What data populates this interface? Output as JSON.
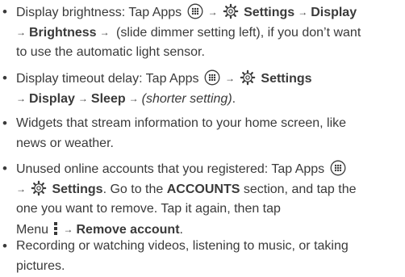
{
  "icons": {
    "apps": "apps-icon",
    "settings": "settings-gear-icon",
    "menu": "menu-overflow-icon",
    "arrow": "→"
  },
  "tips": [
    {
      "bullet": "•",
      "line1": {
        "t1": "Display brightness: Tap Apps",
        "settings": "Settings",
        "display": "Display"
      },
      "line2": {
        "brightness": "Brightness",
        "t1": " (slide dimmer setting left), if you don’t want"
      },
      "line3": {
        "t1": "to use the automatic light sensor."
      }
    },
    {
      "bullet": "•",
      "line1": {
        "t1": "Display timeout delay: Tap Apps",
        "settings": "Settings"
      },
      "line2": {
        "display": "Display",
        "sleep": "Sleep",
        "shorter": "(shorter setting)",
        "end": "."
      }
    },
    {
      "bullet": "•",
      "line1": {
        "t1": "Widgets that stream information to your home screen, like"
      },
      "line2": {
        "t1": "news or weather."
      }
    },
    {
      "bullet": "•",
      "line1": {
        "t1": "Unused online accounts that you registered: Tap Apps"
      },
      "line2": {
        "settings": "Settings",
        "t1": ". Go to the ",
        "accounts": "ACCOUNTS",
        "t2": " section, and tap the"
      },
      "line3": {
        "t1": "one you want to remove. Tap it again, then tap"
      },
      "line4": {
        "menu": "Menu",
        "remove": "Remove account",
        "end": "."
      }
    },
    {
      "bullet": "•",
      "line1": {
        "t1": "Recording or watching videos, listening to music, or taking"
      },
      "line2": {
        "t1": "pictures."
      }
    }
  ]
}
